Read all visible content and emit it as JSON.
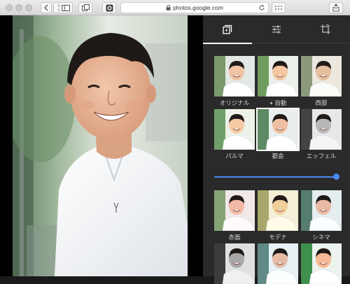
{
  "browser": {
    "url": "photos.google.com"
  },
  "panel": {
    "tabs": [
      {
        "name": "filters",
        "icon": "photo-filter-icon",
        "active": true
      },
      {
        "name": "adjust",
        "icon": "sliders-icon",
        "active": false
      },
      {
        "name": "crop",
        "icon": "crop-rotate-icon",
        "active": false
      }
    ],
    "filters": [
      {
        "label": "オリジナル",
        "tone": "original"
      },
      {
        "label": "自動",
        "tone": "auto",
        "icon": "sparkle-icon"
      },
      {
        "label": "西部",
        "tone": "west"
      },
      {
        "label": "パルマ",
        "tone": "palma"
      },
      {
        "label": "都会",
        "tone": "metro",
        "selected": true
      },
      {
        "label": "エッフェル",
        "tone": "eiffel"
      },
      {
        "label": "赤面",
        "tone": "blush"
      },
      {
        "label": "モデナ",
        "tone": "modena"
      },
      {
        "label": "シネマ",
        "tone": "cinema"
      },
      {
        "label": "",
        "tone": "mono"
      },
      {
        "label": "",
        "tone": "cool"
      },
      {
        "label": "",
        "tone": "vivid"
      }
    ],
    "intensity_slider": {
      "value_fraction": 0.98,
      "color": "#4a8af4"
    }
  }
}
